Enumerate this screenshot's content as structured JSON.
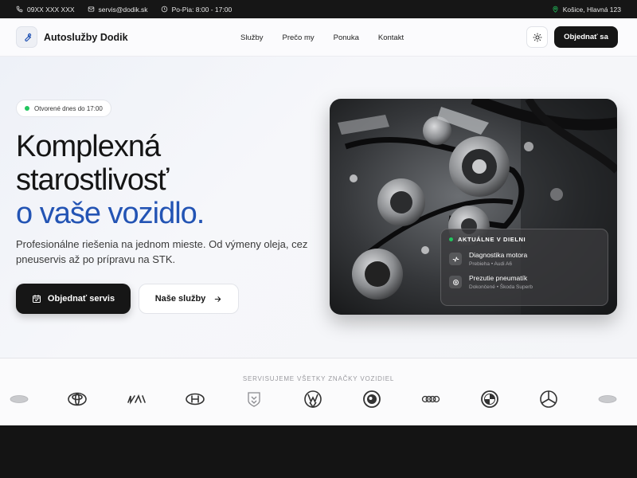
{
  "topbar": {
    "phone": "09XX XXX XXX",
    "email": "servis@dodik.sk",
    "hours": "Po-Pia: 8:00 - 17:00",
    "location": "Košice, Hlavná 123"
  },
  "nav": {
    "brand": "Autoslužby Dodik",
    "links": [
      "Služby",
      "Prečo my",
      "Ponuka",
      "Kontakt"
    ],
    "cta": "Objednať sa"
  },
  "hero": {
    "badge": "Otvorené dnes do 17:00",
    "title_line1": "Komplexná",
    "title_line2": "starostlivosť",
    "title_line3": "o vaše vozidlo.",
    "lead": "Profesionálne riešenia na jednom mieste. Od výmeny oleja, cez pneuservis až po prípravu na STK.",
    "primary_button": "Objednať servis",
    "secondary_button": "Naše služby"
  },
  "workshop": {
    "heading": "AKTUÁLNE V DIELNI",
    "items": [
      {
        "title": "Diagnostika motora",
        "status": "Prebieha • Audi A6",
        "icon": "activity-icon"
      },
      {
        "title": "Prezutie pneumatík",
        "status": "Dokončené • Škoda Superb",
        "icon": "wheel-icon"
      }
    ]
  },
  "brands": {
    "title": "SERVISUJEME VŠETKY ZNAČKY VOZIDIEL",
    "logos": [
      "ford-logo",
      "toyota-logo",
      "kia-logo",
      "hyundai-logo",
      "peugeot-logo",
      "volkswagen-logo",
      "skoda-logo",
      "audi-logo",
      "bmw-logo",
      "mercedes-logo",
      "ford-logo"
    ]
  },
  "colors": {
    "accent": "#2354b4",
    "dark": "#161616",
    "status_green": "#22c55e"
  }
}
